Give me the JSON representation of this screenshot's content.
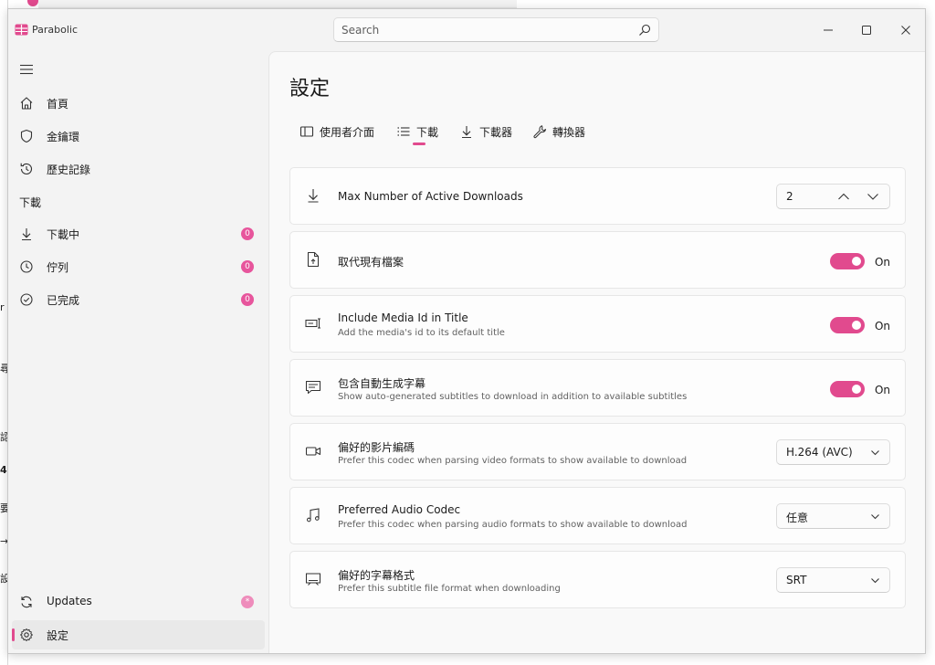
{
  "app": {
    "title": "Parabolic"
  },
  "search": {
    "placeholder": "Search"
  },
  "background": {
    "fragments": [
      "r",
      "尋",
      "認",
      "4",
      "要",
      "→",
      "設"
    ]
  },
  "sidebar": {
    "items": [
      {
        "label": "首頁"
      },
      {
        "label": "金鑰環"
      },
      {
        "label": "歷史記錄"
      }
    ],
    "section_header": "下載",
    "downloads": [
      {
        "label": "下載中",
        "count": "0"
      },
      {
        "label": "佇列",
        "count": "0"
      },
      {
        "label": "已完成",
        "count": "0"
      }
    ],
    "updates": {
      "label": "Updates",
      "badge": "*"
    },
    "settings": {
      "label": "設定"
    }
  },
  "page": {
    "title": "設定",
    "tabs": [
      {
        "label": "使用者介面"
      },
      {
        "label": "下載"
      },
      {
        "label": "下載器"
      },
      {
        "label": "轉換器"
      }
    ],
    "selected_tab": "下載"
  },
  "settings": {
    "max_active": {
      "title": "Max Number of Active Downloads",
      "value": "2"
    },
    "overwrite": {
      "title": "取代現有檔案",
      "state": "On"
    },
    "media_id": {
      "title": "Include Media Id in Title",
      "desc": "Add the media's id to its default title",
      "state": "On"
    },
    "auto_subs": {
      "title": "包含自動生成字幕",
      "desc": "Show auto-generated subtitles to download in addition to available subtitles",
      "state": "On"
    },
    "video_codec": {
      "title": "偏好的影片編碼",
      "desc": "Prefer this codec when parsing video formats to show available to download",
      "value": "H.264 (AVC)"
    },
    "audio_codec": {
      "title": "Preferred Audio Codec",
      "desc": "Prefer this codec when parsing audio formats to show available to download",
      "value": "任意"
    },
    "subtitle_format": {
      "title": "偏好的字幕格式",
      "desc": "Prefer this subtitle file format when downloading",
      "value": "SRT"
    }
  },
  "icons": {
    "app": "parabolic-icon",
    "search": "search-icon",
    "menu": "hamburger-icon",
    "home": "home-icon",
    "keyring": "shield-icon",
    "history": "history-icon",
    "downloading": "download-arrow-icon",
    "queue": "clock-icon",
    "completed": "check-circle-icon",
    "updates": "refresh-icon",
    "settings": "gear-icon"
  },
  "colors": {
    "accent": "#e14a8e",
    "badge": "#e7559c"
  }
}
